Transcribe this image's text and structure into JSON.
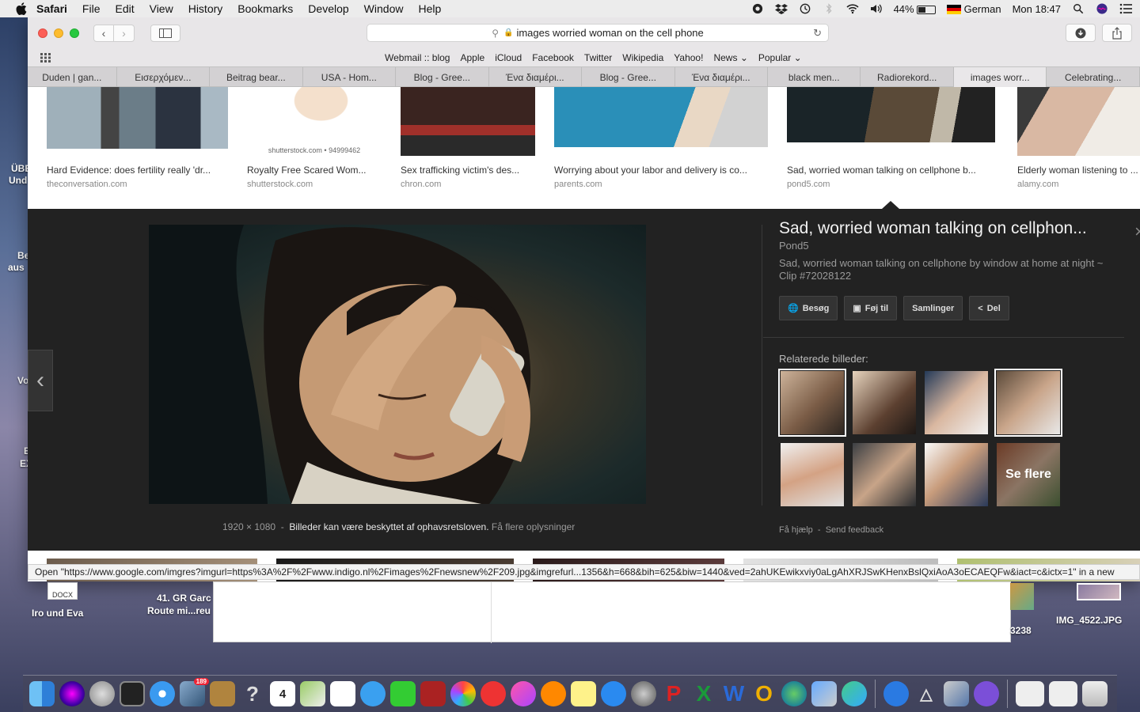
{
  "menubar": {
    "app_name": "Safari",
    "items": [
      "File",
      "Edit",
      "View",
      "History",
      "Bookmarks",
      "Develop",
      "Window",
      "Help"
    ],
    "battery": "44%",
    "input_source": "German",
    "clock": "Mon 18:47"
  },
  "browser": {
    "address": "images  worried woman on the cell phone",
    "bookmarks": [
      "Webmail :: blog",
      "Apple",
      "iCloud",
      "Facebook",
      "Twitter",
      "Wikipedia",
      "Yahoo!",
      "News",
      "Popular"
    ],
    "tabs": [
      {
        "label": "Duden | gan...",
        "active": false
      },
      {
        "label": "Εισερχόμεν...",
        "active": false
      },
      {
        "label": "Beitrag bear...",
        "active": false
      },
      {
        "label": "USA - Hom...",
        "active": false
      },
      {
        "label": "Blog - Gree...",
        "active": false
      },
      {
        "label": "Ένα διαμέρι...",
        "active": false
      },
      {
        "label": "Blog - Gree...",
        "active": false
      },
      {
        "label": "Ένα διαμέρι...",
        "active": false
      },
      {
        "label": "black men...",
        "active": false
      },
      {
        "label": "Radiorekord...",
        "active": false
      },
      {
        "label": "images worr...",
        "active": true
      },
      {
        "label": "Celebrating...",
        "active": false
      }
    ],
    "status_url": "Open \"https://www.google.com/imgres?imgurl=https%3A%2F%2Fwww.indigo.nl%2Fimages%2Fnewsnew%2F209.jpg&imgrefurl...1356&h=668&bih=625&biw=1440&ved=2ahUKEwikxviy0aLgAhXRJSwKHenxBslQxiAoA3oECAEQFw&iact=c&ictx=1\" in a new"
  },
  "results": [
    {
      "caption": "Hard Evidence: does fertility really 'dr...",
      "source": "theconversation.com"
    },
    {
      "caption": "Royalty Free Scared Wom...",
      "source": "shutterstock.com"
    },
    {
      "caption": "Sex trafficking victim's des...",
      "source": "chron.com"
    },
    {
      "caption": "Worrying about your labor and delivery is co...",
      "source": "parents.com"
    },
    {
      "caption": "Sad, worried woman talking on cellphone b...",
      "source": "pond5.com"
    },
    {
      "caption": "Elderly woman listening to ...",
      "source": "alamy.com"
    }
  ],
  "watermark": "shutterstock.com • 94999462",
  "viewer": {
    "title": "Sad, worried woman talking on cellphon...",
    "source": "Pond5",
    "description": "Sad, worried woman talking on cellphone by window at home at night ~ Clip #72028122",
    "buttons": [
      "Besøg",
      "Føj til",
      "Samlinger",
      "Del"
    ],
    "related_label": "Relaterede billeder:",
    "see_more": "Se flere",
    "dimensions": "1920 × 1080",
    "separator": "-",
    "copyright_notice": "Billeder kan være beskyttet af ophavsretsloven.",
    "more_info": "Få flere oplysninger",
    "help": "Få hjælp",
    "feedback": "Send feedback"
  },
  "desktop": {
    "labels": [
      "Iro und Eva",
      "41. GR  Garc",
      "Route mi...reu",
      "3238",
      "IMG_4522.JPG",
      "DOCX"
    ],
    "left_partial": [
      "ÜBE",
      "Und",
      "Be",
      "aus",
      "Vo",
      "E",
      "EX"
    ]
  },
  "colors": {
    "viewer_bg": "#222222",
    "accent_close": "#fc5f57",
    "accent_min": "#fdbc2e",
    "accent_max": "#28c840"
  }
}
